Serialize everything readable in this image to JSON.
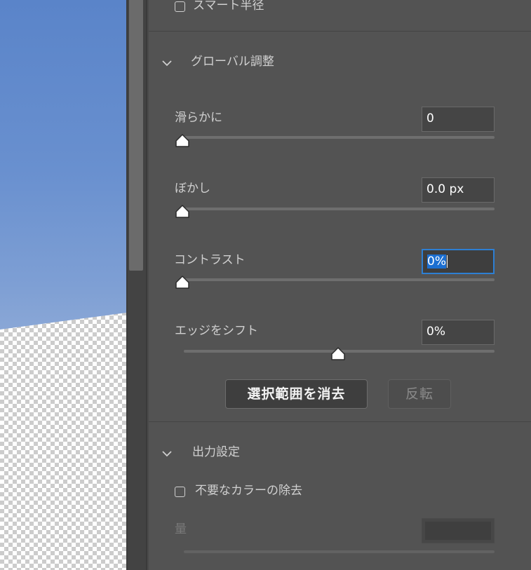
{
  "canvas": {
    "sky_color": "#5a84c9",
    "transparency": "checkerboard"
  },
  "smart_radius": {
    "label": "スマート半径",
    "checked": false
  },
  "global_adjust": {
    "title": "グローバル調整",
    "expanded": true,
    "sliders": [
      {
        "label": "滑らかに",
        "value": "0",
        "fraction": 0.0,
        "focused": false
      },
      {
        "label": "ぼかし",
        "value": "0.0 px",
        "fraction": 0.0,
        "focused": false
      },
      {
        "label": "コントラスト",
        "value": "0%",
        "fraction": 0.0,
        "focused": true
      },
      {
        "label": "エッジをシフト",
        "value": "0%",
        "fraction": 0.5,
        "focused": false
      }
    ],
    "clear_selection_label": "選択範囲を消去",
    "invert_label": "反転"
  },
  "output": {
    "title": "出力設定",
    "expanded": true,
    "decontaminate": {
      "label": "不要なカラーの除去",
      "checked": false
    },
    "amount": {
      "label": "量",
      "value": "",
      "disabled": true
    }
  },
  "colors": {
    "panel_bg": "#535353",
    "focus_ring": "#2d7fd3",
    "selection": "#1c6fd1"
  }
}
